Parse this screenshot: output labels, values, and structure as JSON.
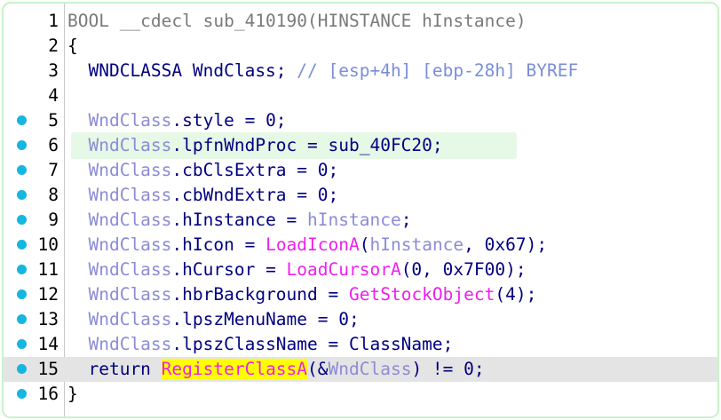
{
  "lines": [
    {
      "n": "1",
      "bp": false,
      "parts": [
        {
          "t": "BOOL __cdecl sub_410190(HINSTANCE hInstance)",
          "c": "g"
        }
      ]
    },
    {
      "n": "2",
      "bp": false,
      "parts": [
        {
          "t": "{",
          "c": "k"
        }
      ]
    },
    {
      "n": "3",
      "bp": false,
      "parts": [
        {
          "t": "  WNDCLASSA WndClass; ",
          "c": "n"
        },
        {
          "t": "// [esp+4h] [ebp-28h] BYREF",
          "c": "c"
        }
      ]
    },
    {
      "n": "4",
      "bp": false,
      "parts": []
    },
    {
      "n": "5",
      "bp": true,
      "parts": [
        {
          "t": "  WndClass",
          "c": "v"
        },
        {
          "t": ".style = 0;",
          "c": "n"
        }
      ]
    },
    {
      "n": "6",
      "bp": true,
      "parts": [
        {
          "t": "  WndClass",
          "c": "v"
        },
        {
          "t": ".lpfnWndProc = sub_40FC20;",
          "c": "n"
        }
      ]
    },
    {
      "n": "7",
      "bp": true,
      "parts": [
        {
          "t": "  WndClass",
          "c": "v"
        },
        {
          "t": ".cbClsExtra = 0;",
          "c": "n"
        }
      ]
    },
    {
      "n": "8",
      "bp": true,
      "parts": [
        {
          "t": "  WndClass",
          "c": "v"
        },
        {
          "t": ".cbWndExtra = 0;",
          "c": "n"
        }
      ]
    },
    {
      "n": "9",
      "bp": true,
      "parts": [
        {
          "t": "  WndClass",
          "c": "v"
        },
        {
          "t": ".hInstance = ",
          "c": "n"
        },
        {
          "t": "hInstance",
          "c": "v"
        },
        {
          "t": ";",
          "c": "n"
        }
      ]
    },
    {
      "n": "10",
      "bp": true,
      "parts": [
        {
          "t": "  WndClass",
          "c": "v"
        },
        {
          "t": ".hIcon = ",
          "c": "n"
        },
        {
          "t": "LoadIconA",
          "c": "f"
        },
        {
          "t": "(",
          "c": "n"
        },
        {
          "t": "hInstance",
          "c": "v"
        },
        {
          "t": ", 0x67);",
          "c": "n"
        }
      ]
    },
    {
      "n": "11",
      "bp": true,
      "parts": [
        {
          "t": "  WndClass",
          "c": "v"
        },
        {
          "t": ".hCursor = ",
          "c": "n"
        },
        {
          "t": "LoadCursorA",
          "c": "f"
        },
        {
          "t": "(0, 0x7F00);",
          "c": "n"
        }
      ]
    },
    {
      "n": "12",
      "bp": true,
      "parts": [
        {
          "t": "  WndClass",
          "c": "v"
        },
        {
          "t": ".hbrBackground = ",
          "c": "n"
        },
        {
          "t": "GetStockObject",
          "c": "f"
        },
        {
          "t": "(4);",
          "c": "n"
        }
      ]
    },
    {
      "n": "13",
      "bp": true,
      "parts": [
        {
          "t": "  WndClass",
          "c": "v"
        },
        {
          "t": ".lpszMenuName = 0;",
          "c": "n"
        }
      ]
    },
    {
      "n": "14",
      "bp": true,
      "parts": [
        {
          "t": "  WndClass",
          "c": "v"
        },
        {
          "t": ".lpszClassName = ClassName;",
          "c": "n"
        }
      ]
    },
    {
      "n": "15",
      "bp": true,
      "current": true,
      "parts": [
        {
          "t": "  return ",
          "c": "n"
        },
        {
          "t": "RegisterClassA",
          "c": "f",
          "hl": true
        },
        {
          "t": "(&",
          "c": "n"
        },
        {
          "t": "WndClass",
          "c": "v"
        },
        {
          "t": ") != 0;",
          "c": "n"
        }
      ]
    },
    {
      "n": "16",
      "bp": true,
      "parts": [
        {
          "t": "}",
          "c": "k"
        }
      ]
    }
  ],
  "colors": {
    "breakpoint_dot": "#15b6e0",
    "variable": "#8b8bd6",
    "function": "#ee1fee",
    "comment": "#7a8ed8",
    "code": "#000080",
    "current_line_bg": "#e4e4e4",
    "selected_line_bg": "#e6f8e6",
    "search_highlight": "#ffff00"
  }
}
